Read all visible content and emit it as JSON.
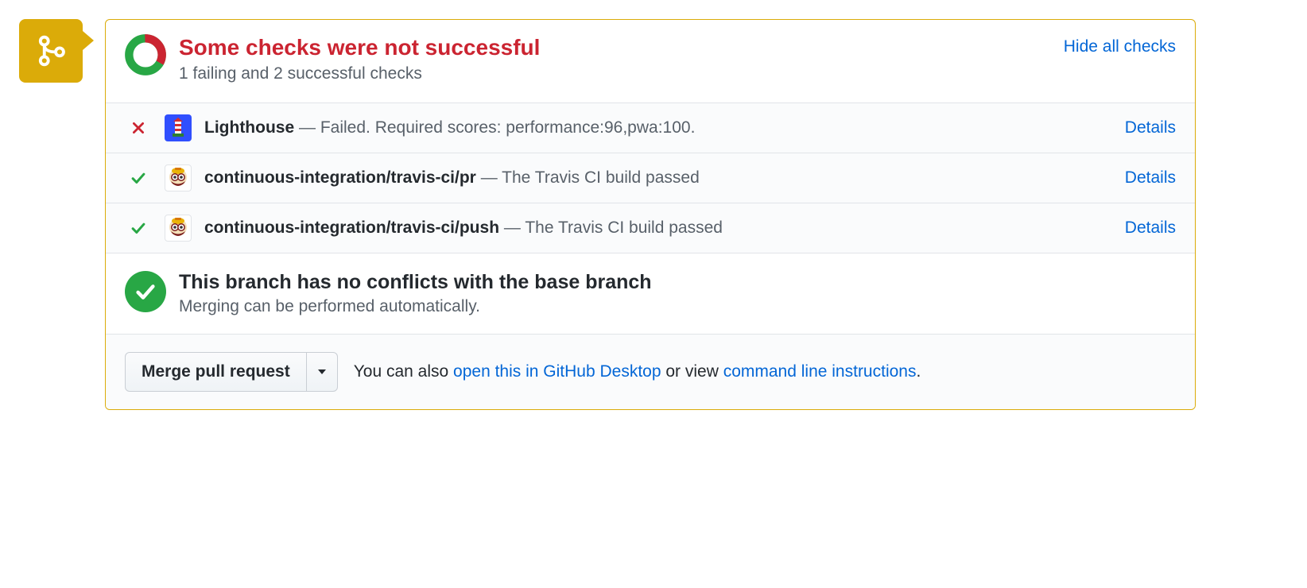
{
  "header": {
    "title": "Some checks were not successful",
    "subtitle": "1 failing and 2 successful checks",
    "hide_link": "Hide all checks"
  },
  "donut": {
    "success_count": 2,
    "fail_count": 1,
    "success_fraction": 0.6667,
    "colors": {
      "success": "#28a745",
      "fail": "#cb2431"
    }
  },
  "checks": [
    {
      "status": "fail",
      "service_icon": "lighthouse",
      "name": "Lighthouse",
      "description": "Failed. Required scores: performance:96,pwa:100.",
      "details_label": "Details"
    },
    {
      "status": "pass",
      "service_icon": "travis",
      "name": "continuous-integration/travis-ci/pr",
      "description": "The Travis CI build passed",
      "details_label": "Details"
    },
    {
      "status": "pass",
      "service_icon": "travis",
      "name": "continuous-integration/travis-ci/push",
      "description": "The Travis CI build passed",
      "details_label": "Details"
    }
  ],
  "conflicts": {
    "title": "This branch has no conflicts with the base branch",
    "subtitle": "Merging can be performed automatically."
  },
  "footer": {
    "merge_button": "Merge pull request",
    "text_prefix": "You can also ",
    "desktop_link": "open this in GitHub Desktop",
    "text_mid": " or view ",
    "cli_link": "command line instructions",
    "text_suffix": "."
  }
}
